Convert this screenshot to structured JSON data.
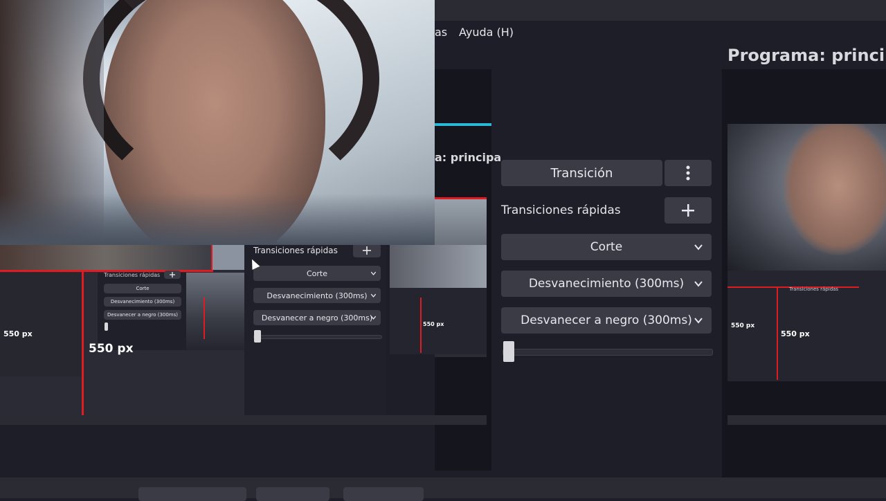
{
  "menubar": {
    "items": [
      {
        "label": "as"
      },
      {
        "label": "Ayuda (H)"
      }
    ]
  },
  "program": {
    "title": "Programa: principa",
    "title_small": "a: principa"
  },
  "transitions": {
    "transition_button": "Transición",
    "quick_transitions_label": "Transiciones rápidas",
    "add_icon": "plus-icon",
    "more_icon": "kebab-icon",
    "items": [
      {
        "label": "Corte"
      },
      {
        "label": "Desvanecimiento (300ms)"
      },
      {
        "label": "Desvanecer a negro (300ms)"
      }
    ],
    "slider_value": 0
  },
  "nested": {
    "quick_transitions_label": "Transiciones rápidas",
    "items": [
      {
        "label": "Corte"
      },
      {
        "label": "Desvanecimiento (300ms)"
      },
      {
        "label": "Desvanecer a negro (300ms)"
      }
    ],
    "px_label_large": "550 px",
    "px_label_small": "550 px",
    "mini_label": "Transiciones rápidas",
    "mini_items": [
      {
        "label": "Corte"
      },
      {
        "label": "Desvanecimiento (300ms)"
      },
      {
        "label": "Desvanecer a negro (300ms)"
      }
    ]
  },
  "colors": {
    "accent_cyan": "#2bb7d6",
    "guide_red": "#e11b22",
    "panel_bg": "#1d1e27",
    "button_bg": "#3a3b45"
  }
}
